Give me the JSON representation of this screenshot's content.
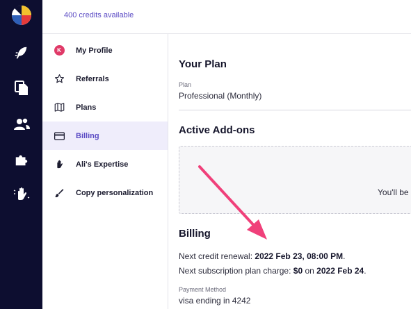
{
  "colors": {
    "rail_bg": "#0d0e30",
    "accent": "#5b4bc4",
    "active_bg": "#efedfb",
    "arrow": "#f0407a",
    "avatar": "#e03a68"
  },
  "rail": {
    "items": [
      {
        "icon": "app-logo-icon"
      },
      {
        "icon": "feather-icon"
      },
      {
        "icon": "documents-icon"
      },
      {
        "icon": "users-icon"
      },
      {
        "icon": "puzzle-icon"
      },
      {
        "icon": "hand-icon"
      }
    ]
  },
  "header": {
    "credits": "400 credits available"
  },
  "sidebar": {
    "items": [
      {
        "label": "My Profile",
        "icon": "avatar",
        "avatar_letter": "K"
      },
      {
        "label": "Referrals",
        "icon": "star-icon"
      },
      {
        "label": "Plans",
        "icon": "map-icon"
      },
      {
        "label": "Billing",
        "icon": "credit-card-icon",
        "active": true
      },
      {
        "label": "Ali's Expertise",
        "icon": "hand-icon"
      },
      {
        "label": "Copy personalization",
        "icon": "brush-icon"
      }
    ]
  },
  "plan": {
    "title": "Your Plan",
    "label": "Plan",
    "value": "Professional (Monthly)"
  },
  "addons": {
    "title": "Active Add-ons",
    "message": "You'll be"
  },
  "billing": {
    "title": "Billing",
    "renewal_prefix": "Next credit renewal:",
    "renewal_date": "2022 Feb 23, 08:00 PM",
    "renewal_suffix": ".",
    "charge_prefix": "Next subscription plan charge:",
    "charge_amount": "$0",
    "charge_on": "on",
    "charge_date": "2022 Feb 24",
    "charge_suffix": ".",
    "payment_label": "Payment Method",
    "payment_value": "visa ending in 4242"
  }
}
